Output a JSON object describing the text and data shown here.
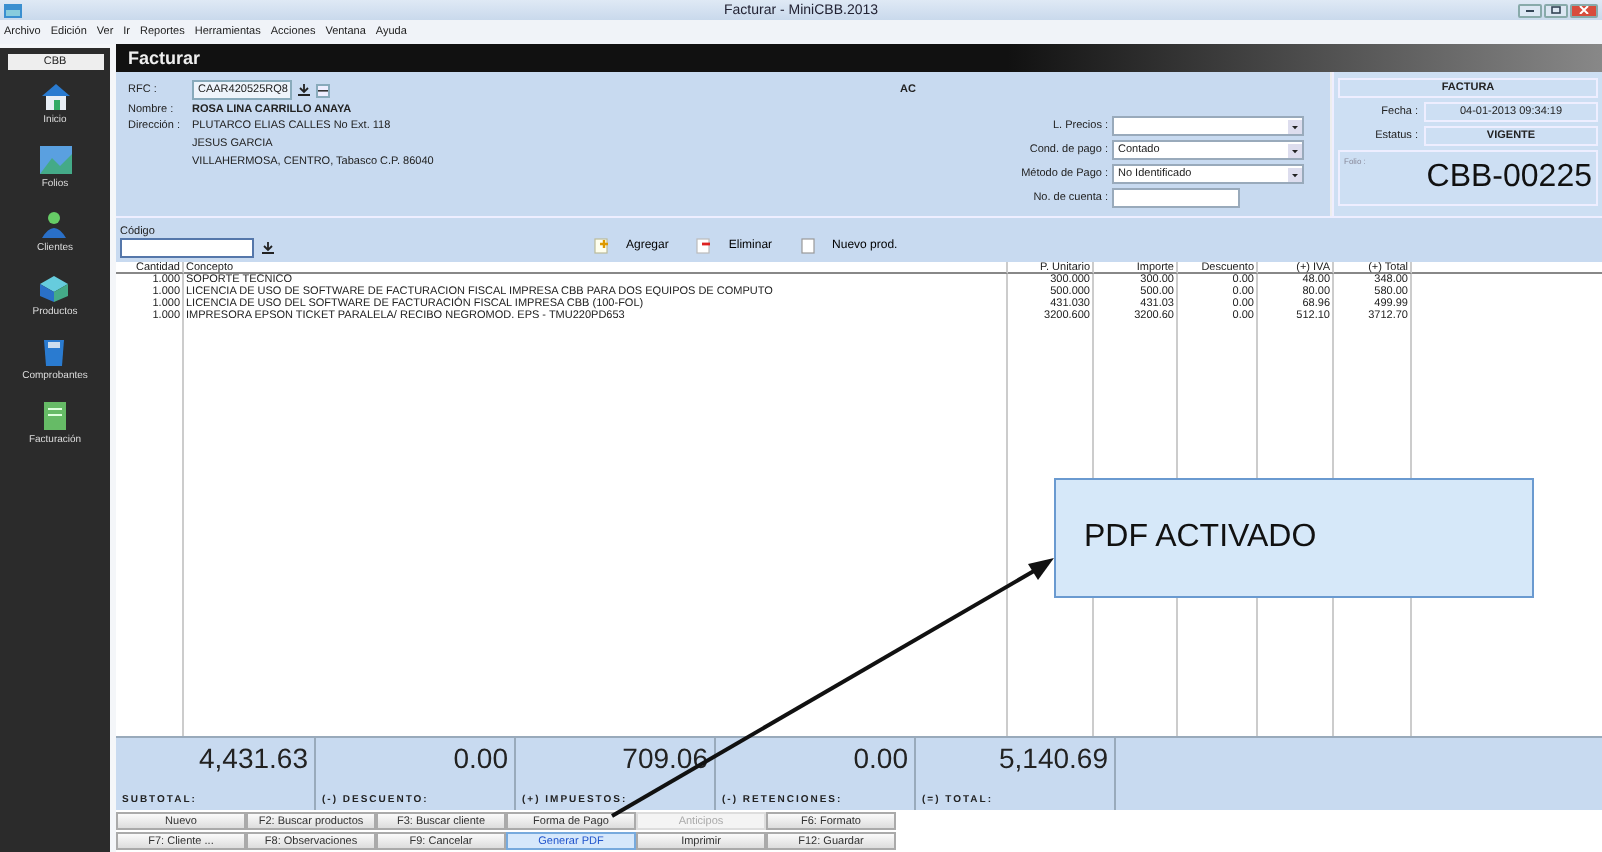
{
  "window": {
    "title": "Facturar - MiniCBB.2013"
  },
  "menu": [
    "Archivo",
    "Edición",
    "Ver",
    "Ir",
    "Reportes",
    "Herramientas",
    "Acciones",
    "Ventana",
    "Ayuda"
  ],
  "sidebar": {
    "title": "CBB",
    "items": [
      {
        "label": "Inicio",
        "kind": "house"
      },
      {
        "label": "Folios",
        "kind": "picture"
      },
      {
        "label": "Clientes",
        "kind": "person"
      },
      {
        "label": "Productos",
        "kind": "box"
      },
      {
        "label": "Comprobantes",
        "kind": "bin"
      },
      {
        "label": "Facturación",
        "kind": "doc"
      }
    ]
  },
  "panel_title": "Facturar",
  "customer": {
    "rfc_label": "RFC :",
    "rfc": "CAAR420525RQ8",
    "name_label": "Nombre :",
    "name": "ROSA LINA CARRILLO ANAYA",
    "address_label": "Dirección :",
    "address": [
      "PLUTARCO ELIAS CALLES No Ext. 118",
      "JESUS GARCIA",
      "VILLAHERMOSA, CENTRO, Tabasco C.P. 86040"
    ],
    "code": "AC"
  },
  "payment": [
    {
      "label": "L. Precios :"
    },
    {
      "label": "Cond. de pago :",
      "value": "Contado"
    },
    {
      "label": "Método de Pago :",
      "value": "No Identificado"
    }
  ],
  "account": {
    "label": "No. de cuenta :"
  },
  "invoice": {
    "type": "FACTURA",
    "date_label": "Fecha :",
    "date": "04-01-2013 09:34:19",
    "status_label": "Estatus :",
    "status": "VIGENTE",
    "folio_label": "Folio :",
    "folio": "CBB-00225"
  },
  "code_field": {
    "label": "Código"
  },
  "actions": [
    {
      "label": "Agregar",
      "kind": "add"
    },
    {
      "label": "Eliminar",
      "kind": "delete"
    },
    {
      "label": "Nuevo prod.",
      "kind": "new"
    }
  ],
  "table": {
    "columns": [
      "Cantidad",
      "Concepto",
      "P. Unitario",
      "Importe",
      "Descuento",
      "(+) IVA",
      "(+) Total"
    ],
    "rows": [
      [
        "1.000",
        "SOPORTE TECNICO",
        "300.000",
        "300.00",
        "0.00",
        "48.00",
        "348.00"
      ],
      [
        "1.000",
        "LICENCIA DE USO  DE SOFTWARE DE FACTURACION FISCAL IMPRESA CBB PARA DOS EQUIPOS DE COMPUTO",
        "500.000",
        "500.00",
        "0.00",
        "80.00",
        "580.00"
      ],
      [
        "1.000",
        "LICENCIA DE USO DEL SOFTWARE DE FACTURACIÓN FISCAL IMPRESA CBB (100-FOL)",
        "431.030",
        "431.03",
        "0.00",
        "68.96",
        "499.99"
      ],
      [
        "1.000",
        "IMPRESORA EPSON  TICKET PARALELA/ RECIBO NEGROMOD. EPS - TMU220PD653",
        "3200.600",
        "3200.60",
        "0.00",
        "512.10",
        "3712.70"
      ]
    ]
  },
  "totals": [
    {
      "value": "4,431.63",
      "label": "SUBTOTAL:"
    },
    {
      "value": "0.00",
      "label": "(-) DESCUENTO:"
    },
    {
      "value": "709.06",
      "label": "(+) IMPUESTOS:"
    },
    {
      "value": "0.00",
      "label": "(-) RETENCIONES:"
    },
    {
      "value": "5,140.69",
      "label": "(=) TOTAL:"
    }
  ],
  "buttons": [
    [
      {
        "label": "Nuevo",
        "disabled": false,
        "selected": false
      },
      {
        "label": "F2: Buscar productos",
        "disabled": false,
        "selected": false
      },
      {
        "label": "F3: Buscar cliente",
        "disabled": false,
        "selected": false
      },
      {
        "label": "Forma de Pago",
        "disabled": false,
        "selected": false
      },
      {
        "label": "Anticipos",
        "disabled": true,
        "selected": false
      },
      {
        "label": "F6:  Formato",
        "disabled": false,
        "selected": false
      }
    ],
    [
      {
        "label": "F7: Cliente ...",
        "disabled": false,
        "selected": false
      },
      {
        "label": "F8: Observaciones",
        "disabled": false,
        "selected": false
      },
      {
        "label": "F9: Cancelar",
        "disabled": false,
        "selected": false
      },
      {
        "label": "Generar PDF",
        "disabled": false,
        "selected": true
      },
      {
        "label": "Imprimir",
        "disabled": false,
        "selected": false
      },
      {
        "label": "F12: Guardar",
        "disabled": false,
        "selected": false
      }
    ]
  ],
  "annotation": {
    "text": "PDF ACTIVADO"
  }
}
